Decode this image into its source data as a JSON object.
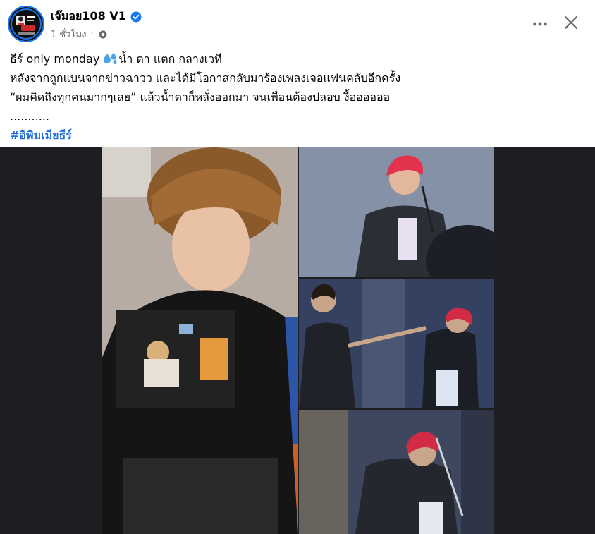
{
  "post": {
    "author": "เจ๊มอย108 V1",
    "verified_icon": "verified-badge-icon",
    "time": "1 ชั่วโมง",
    "separator": "·",
    "audience_icon": "gear-icon",
    "more_icon": "more-options-icon",
    "close_icon": "close-icon",
    "text": {
      "line1_a": "ธีร์ only monday ",
      "line1_b": "น้ำ ตา แตก กลางเวที",
      "line2": "หลังจากถูกแบนจากข่าวฉาวว และได้มีโอกาสกลับมาร้องเพลงเจอแฟนคลับอีกครั้ง",
      "line3": " “ผมคิดถึงทุกคนมากๆเลย”  แล้วน้ำตาก็หลั่งออกมา จนเพื่อนต้องปลอบ  งื้ออออออ",
      "line4": "...........",
      "hashtag": "#อิพิมเมียธีร์"
    }
  },
  "colors": {
    "accent": "#1877f2",
    "hashtag": "#216fdb",
    "meta": "#65676b",
    "media_bg": "#1c1e21"
  },
  "media": {
    "photos": [
      {
        "name": "photo-main",
        "desc_icon": "portrait-photo"
      },
      {
        "name": "photo-stage-singing",
        "desc_icon": "stage-photo"
      },
      {
        "name": "photo-stage-comfort",
        "desc_icon": "stage-photo"
      },
      {
        "name": "photo-stage-crying",
        "desc_icon": "stage-photo"
      }
    ]
  }
}
